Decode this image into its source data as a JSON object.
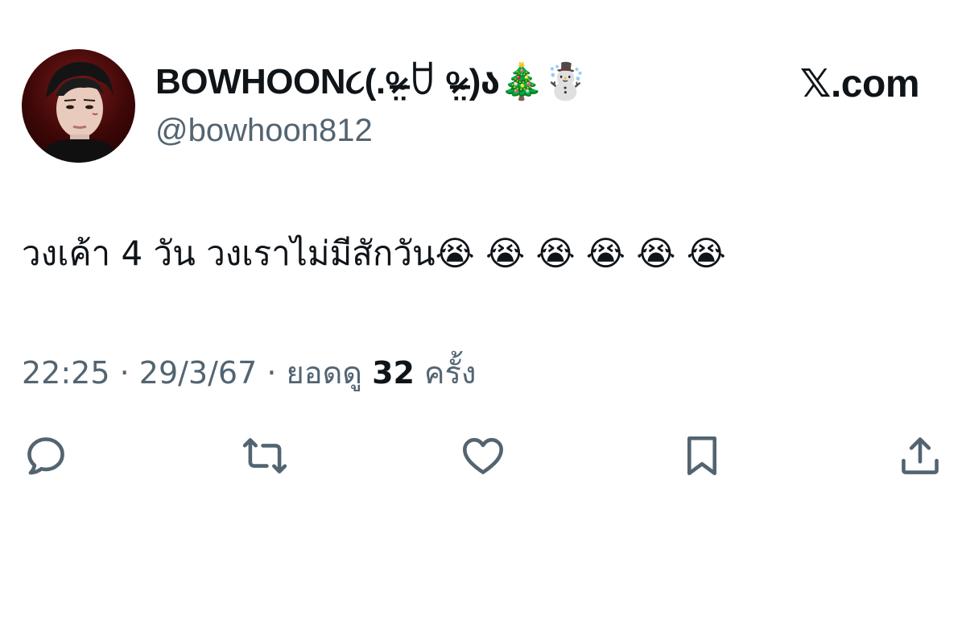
{
  "user": {
    "display_name": "BOWHOON૮(.ᵒ̴̶̷̤ ꇴ ᵒ̴̶̷̤ )ა🎄☃️",
    "handle": "@bowhoon812",
    "avatar_alt": "profile-photo"
  },
  "site": {
    "x_mark": "𝕏",
    "domain": ".com"
  },
  "tweet": {
    "text": "วงเค้า 4 วัน วงเราไม่มีสักวัน😭 😭 😭 😭 😭 😭"
  },
  "meta": {
    "time": "22:25",
    "separator": " · ",
    "date": "29/3/67",
    "views_label": "ยอดดู",
    "views_count": "32",
    "views_unit": "ครั้ง"
  },
  "actions": {
    "icons": [
      "reply-icon",
      "retweet-icon",
      "like-icon",
      "bookmark-icon",
      "share-icon"
    ],
    "icon_color": "#536471"
  }
}
